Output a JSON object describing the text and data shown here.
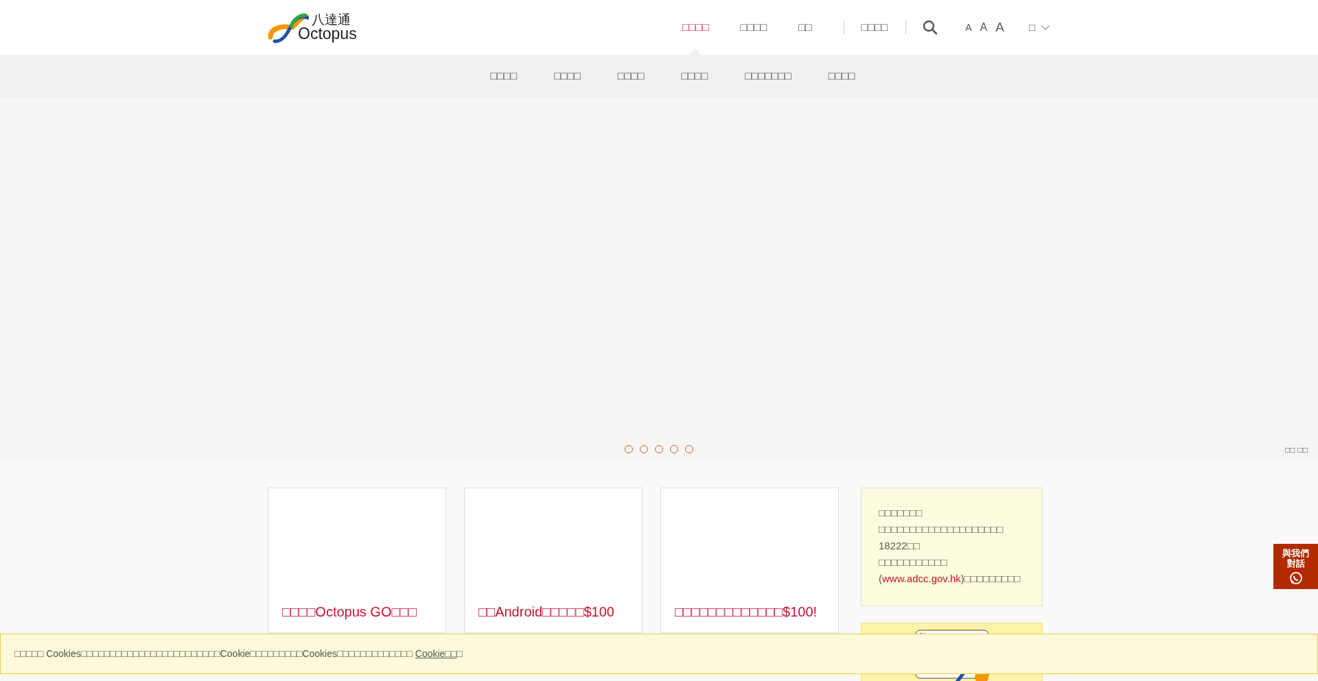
{
  "header": {
    "logo_text": "八達通",
    "logo_wordmark": "Octopus",
    "nav": [
      {
        "label": "□□□□",
        "selected": true
      },
      {
        "label": "□□□□",
        "selected": false
      },
      {
        "label": "□□",
        "selected": false
      },
      {
        "label": "□□□□",
        "selected": false
      }
    ],
    "font_sizes": [
      "A",
      "A",
      "A"
    ],
    "language": "□"
  },
  "subnav": [
    "□□□□",
    "□□□□",
    "□□□□",
    "□□□□",
    "□□□□□□□",
    "□□□□"
  ],
  "hero": {
    "dots": [
      {
        "selected": false
      },
      {
        "selected": false
      },
      {
        "selected": false
      },
      {
        "selected": false
      },
      {
        "selected": false
      }
    ],
    "controls": [
      "□□",
      "□□"
    ]
  },
  "cards": [
    {
      "title": "□□□□Octopus GO□□□"
    },
    {
      "title": "□□Android□□□□□$100"
    },
    {
      "title": "□□□□□□□□□□□□□$100!"
    }
  ],
  "notice": {
    "heading": "□□□□□□□",
    "lines": [
      "□□□□□□□□□□□□□□□□□□□□",
      "18222□□",
      "□□□□□□□□□□□"
    ],
    "link": "www.adcc.gov.hk",
    "open": "(",
    "after": ")□□□□□□□□□"
  },
  "chat": {
    "label": "與我們對話"
  },
  "cookie": {
    "text": "□□□□□ Cookies□□□□□□□□□□□□□□□□□□□□□□□□Cookie□□□□□□□□□Cookies□□□□□□□□□□□□□",
    "link": "Cookie□□",
    "end": "□"
  }
}
